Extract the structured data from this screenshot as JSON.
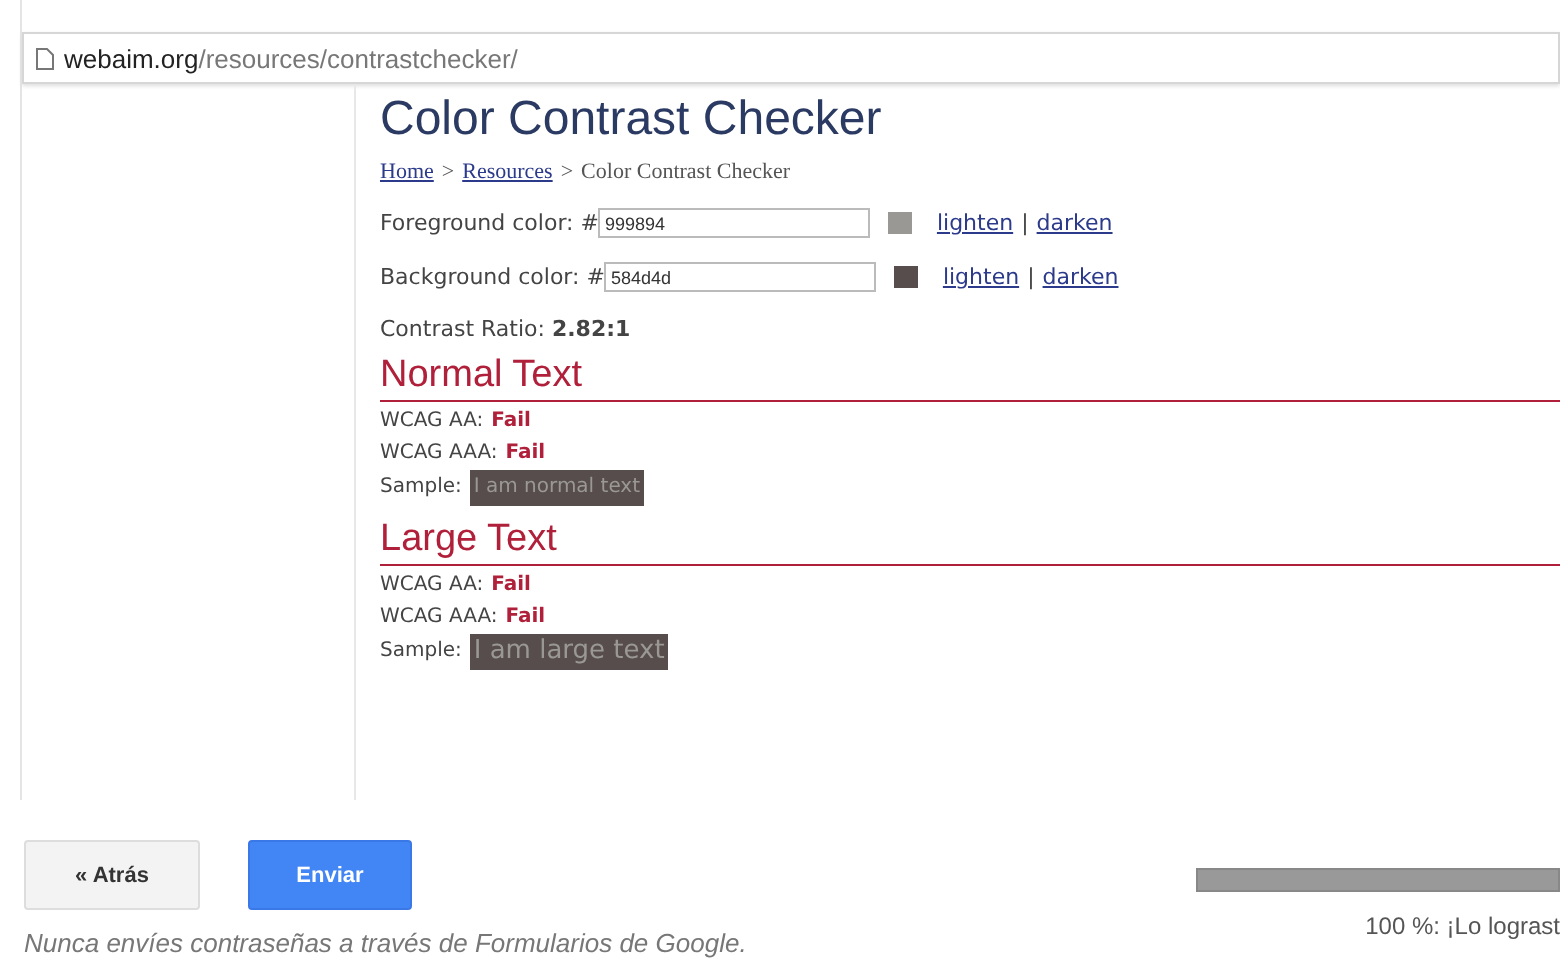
{
  "address_bar": {
    "domain": "webaim.org",
    "path": "/resources/contrastchecker/"
  },
  "page": {
    "title": "Color Contrast Checker",
    "breadcrumb": [
      {
        "label": "Home",
        "kind": "link"
      },
      {
        "label": ">",
        "kind": "separator"
      },
      {
        "label": "Resources",
        "kind": "link"
      },
      {
        "label": ">",
        "kind": "separator"
      },
      {
        "label": "Color Contrast Checker",
        "kind": "current"
      }
    ],
    "fields": [
      {
        "label": "Foreground color: #",
        "value": "999894",
        "links": [
          "lighten",
          "darken"
        ],
        "separator": "|"
      },
      {
        "label": "Background color: #",
        "value": "584d4d",
        "links": [
          "lighten",
          "darken"
        ],
        "separator": "|"
      }
    ],
    "ratio": {
      "label": "Contrast Ratio:",
      "value": "2.82:1"
    },
    "sections": [
      {
        "title": "Normal Text",
        "kind": "normal",
        "results": [
          {
            "label": "WCAG AA:",
            "value": "Fail"
          },
          {
            "label": "WCAG AAA:",
            "value": "Fail"
          }
        ],
        "sample_label": "Sample:",
        "sample": "I am normal text"
      },
      {
        "title": "Large Text",
        "kind": "large",
        "results": [
          {
            "label": "WCAG AA:",
            "value": "Fail"
          },
          {
            "label": "WCAG AAA:",
            "value": "Fail"
          }
        ],
        "sample_label": "Sample:",
        "sample": "I am large text"
      }
    ]
  },
  "form": {
    "back_button": "« Atrás",
    "submit_button": "Enviar",
    "progress": {
      "level": 1,
      "text": "100 %: ¡Lo lograst"
    },
    "notice": "Nunca envíes contraseñas a través de Formularios de Google."
  }
}
